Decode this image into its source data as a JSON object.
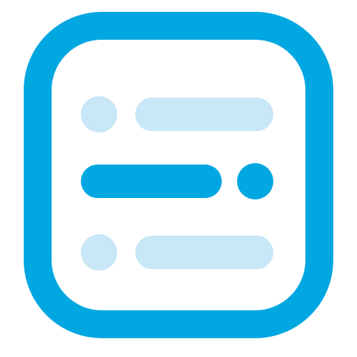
{
  "app": {
    "icon_name": "list-layout-icon",
    "colors": {
      "primary": "#00a7e1",
      "light": "#c8e7f7",
      "background": "#ffffff"
    }
  }
}
